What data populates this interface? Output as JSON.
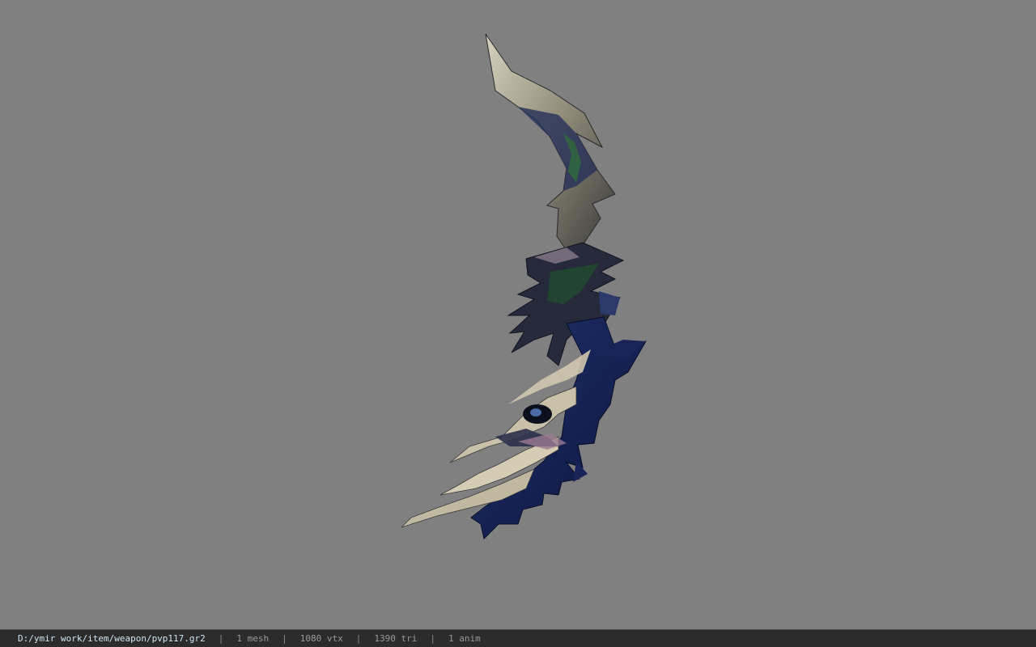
{
  "viewer": {
    "background_color": "#808080",
    "model_icon": "curved-blade-weapon-icon"
  },
  "status_bar": {
    "file_path": "D:/ymir work/item/weapon/pvp117.gr2",
    "separator": "|",
    "mesh_count": "1 mesh",
    "vertex_count": "1080 vtx",
    "triangle_count": "1390 tri",
    "anim_count": "1 anim",
    "path_color": "#cfe6f2"
  }
}
